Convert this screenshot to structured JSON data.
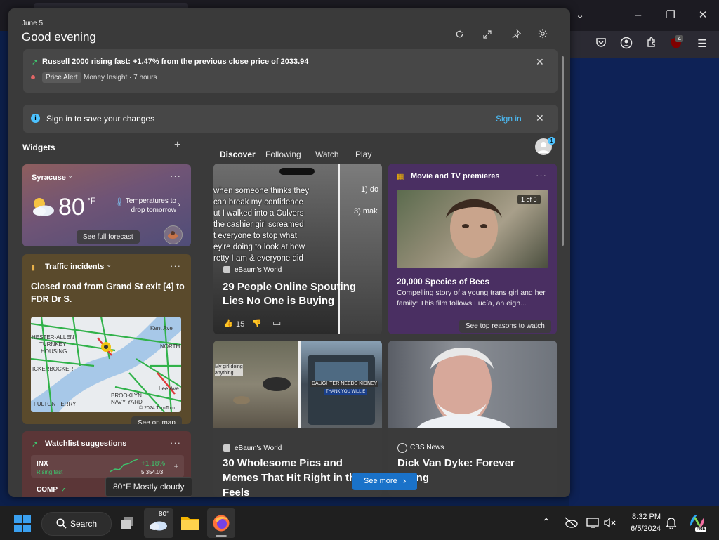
{
  "header": {
    "date": "June 5",
    "greeting": "Good evening"
  },
  "alert": {
    "text": "Russell 2000 rising fast: +1.47% from the previous close price of 2033.94",
    "tag": "Price Alert",
    "source": "Money Insight · 7 hours"
  },
  "signin": {
    "text": "Sign in to save your changes",
    "link": "Sign in"
  },
  "widgets_title": "Widgets",
  "add_symbol": "+",
  "feed_tabs": [
    "Discover",
    "Following",
    "Watch",
    "Play"
  ],
  "avatar_badge": "1",
  "weather": {
    "location": "Syracuse",
    "temp": "80",
    "unit": "°F",
    "note": "Temperatures to drop tomorrow",
    "button": "See full forecast"
  },
  "traffic": {
    "title": "Traffic incidents",
    "headline": "Closed road from Grand St exit [4] to FDR Dr S.",
    "map_labels": [
      "HESTER-ALLEN",
      "TURNKEY",
      "HOUSING",
      "ICKERBOCKER",
      "FULTON FERRY",
      "BROOKLYN",
      "NAVY YARD",
      "NORTH",
      "Kent Ave",
      "Lee Ave"
    ],
    "copyright": "© 2024 TomTom",
    "button": "See on map"
  },
  "watchlist": {
    "title": "Watchlist suggestions",
    "rows": [
      {
        "symbol": "INX",
        "sub": "Rising fast",
        "change": "+1.18%",
        "price": "5,354.03"
      },
      {
        "symbol": "COMP",
        "sub": "",
        "change": "",
        "price": ""
      }
    ]
  },
  "news1": {
    "overlay": [
      "when someone thinks they",
      "can break my confidence",
      "ut I walked into a Culvers",
      "the cashier girl screamed",
      "t everyone to stop what",
      "ey're doing to look at how",
      "retty I am & everyone did"
    ],
    "side": [
      "1) do",
      "3) mak"
    ],
    "source": "eBaum's World",
    "title": "29 People Online Spouting Lies No One is Buying",
    "likes": "15"
  },
  "movie": {
    "title": "Movie and TV premieres",
    "counter": "1 of 5",
    "headline": "20,000 Species of Bees",
    "desc": "Compelling story of a young trans girl and her family: This film follows Lucía, an eigh...",
    "button": "See top reasons to watch"
  },
  "news3": {
    "img_text": [
      "My girl doing anything.",
      "DAUGHTER NEEDS KIDNEY",
      "THANK YOU WILLIE"
    ],
    "source": "eBaum's World",
    "title": "30 Wholesome Pics and Memes That Hit Right in the Feels"
  },
  "news4": {
    "source": "CBS News",
    "title": "Dick Van Dyke: Forever young"
  },
  "see_more": "See more",
  "tooltip": "80°F Mostly cloudy",
  "taskbar": {
    "search": "Search",
    "weather_temp": "80°",
    "time": "8:32 PM",
    "date": "6/5/2024",
    "copilot_badge": "PRE"
  },
  "browser": {
    "ublock_count": "4"
  },
  "colors": {
    "panel": "#3a3a3a",
    "accent": "#4cc2ff",
    "movie_card": "#4a2f62",
    "traffic_card": "#5a4a2c",
    "watchlist_card": "#5b3637"
  }
}
